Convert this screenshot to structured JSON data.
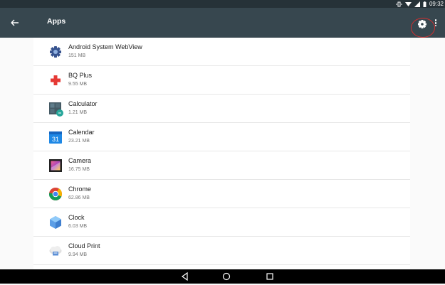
{
  "status_bar": {
    "time": "09:32",
    "icons": [
      "vibrate-icon",
      "wifi-icon",
      "signal-icon",
      "battery-icon"
    ]
  },
  "app_bar": {
    "title": "Apps",
    "back_icon": "arrow-back-icon",
    "settings_icon": "gear-icon",
    "more_icon": "more-vert-icon"
  },
  "colors": {
    "status_bar": "#263238",
    "app_bar": "#37474f",
    "annotation": "#d32f2f",
    "nav_bar": "#000000"
  },
  "apps": [
    {
      "name": "Android System WebView",
      "size": "151 MB",
      "icon": "webview-gear-icon"
    },
    {
      "name": "BQ Plus",
      "size": "9.55 MB",
      "icon": "bq-plus-icon"
    },
    {
      "name": "Calculator",
      "size": "1.21 MB",
      "icon": "calculator-icon"
    },
    {
      "name": "Calendar",
      "size": "23.21 MB",
      "icon": "calendar-icon",
      "icon_text": "31"
    },
    {
      "name": "Camera",
      "size": "16.75 MB",
      "icon": "camera-icon"
    },
    {
      "name": "Chrome",
      "size": "62.86 MB",
      "icon": "chrome-icon"
    },
    {
      "name": "Clock",
      "size": "6.03 MB",
      "icon": "clock-icon"
    },
    {
      "name": "Cloud Print",
      "size": "9.94 MB",
      "icon": "cloud-print-icon"
    }
  ],
  "nav_bar": {
    "buttons": [
      "back-triangle-icon",
      "home-circle-icon",
      "recents-square-icon"
    ]
  }
}
